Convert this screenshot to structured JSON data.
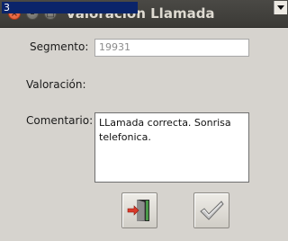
{
  "window": {
    "title": "Valoración Llamada",
    "controls": {
      "close": "×",
      "minimize": "–",
      "maximize": "□"
    }
  },
  "form": {
    "segmento": {
      "label": "Segmento:",
      "value": "19931"
    },
    "valoracion": {
      "label": "Valoración:",
      "selected": "3"
    },
    "comentario": {
      "label": "Comentario:",
      "value": "LLamada correcta. Sonrisa telefonica."
    }
  },
  "buttons": [
    {
      "name": "exit",
      "icon": "exit-door-icon"
    },
    {
      "name": "accept",
      "icon": "checkmark-icon"
    }
  ],
  "colors": {
    "titlebar": "#3b3a36",
    "background": "#d6d3ce",
    "selection": "#0a246a",
    "close_button": "#e0542c"
  }
}
